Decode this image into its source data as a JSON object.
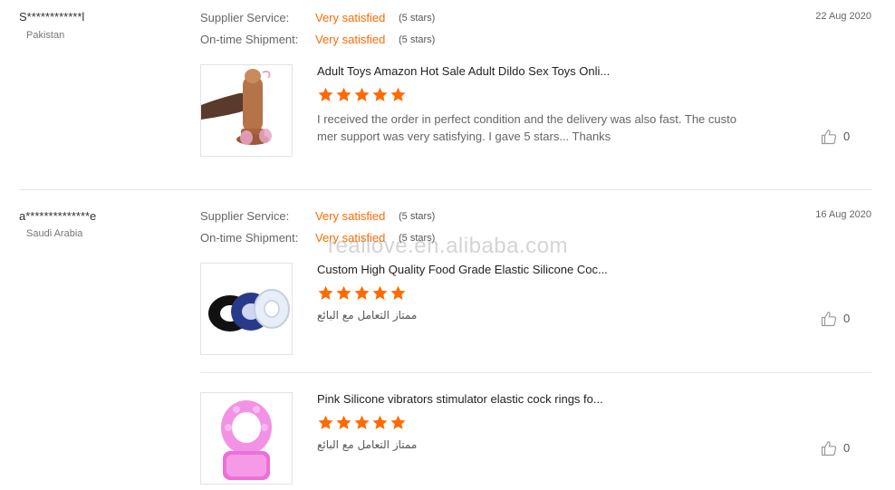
{
  "reviews": [
    {
      "buyer": "S************l",
      "country": "Pakistan",
      "date": "22 Aug 2020",
      "supplier_label": "Supplier Service:",
      "supplier_value": "Very satisfied",
      "supplier_stars": "(5 stars)",
      "shipment_label": "On-time Shipment:",
      "shipment_value": "Very satisfied",
      "shipment_stars": "(5 stars)",
      "products": [
        {
          "name": "Adult Toys Amazon Hot Sale Adult Dildo Sex Toys Onli...",
          "rating": 5,
          "text_line1": "I received the order in perfect condition and the delivery was also fast. The custo",
          "text_line2": "mer support was very satisfying. I gave 5 stars... Thanks",
          "likes": "0"
        }
      ]
    },
    {
      "buyer": "a**************e",
      "country": "Saudi Arabia",
      "date": "16 Aug 2020",
      "supplier_label": "Supplier Service:",
      "supplier_value": "Very satisfied",
      "supplier_stars": "(5 stars)",
      "shipment_label": "On-time Shipment:",
      "shipment_value": "Very satisfied",
      "shipment_stars": "(5 stars)",
      "products": [
        {
          "name": "Custom High Quality Food Grade Elastic Silicone Coc...",
          "rating": 5,
          "text": "ممتاز التعامل مع البائع",
          "likes": "0"
        },
        {
          "name": "Pink Silicone vibrators stimulator elastic cock rings fo...",
          "rating": 5,
          "text": "ممتاز التعامل مع البائع",
          "likes": "0"
        }
      ]
    }
  ],
  "watermark": "reallove.en.alibaba.com",
  "colors": {
    "accent": "#ff6a00",
    "star": "#ff6a00"
  }
}
